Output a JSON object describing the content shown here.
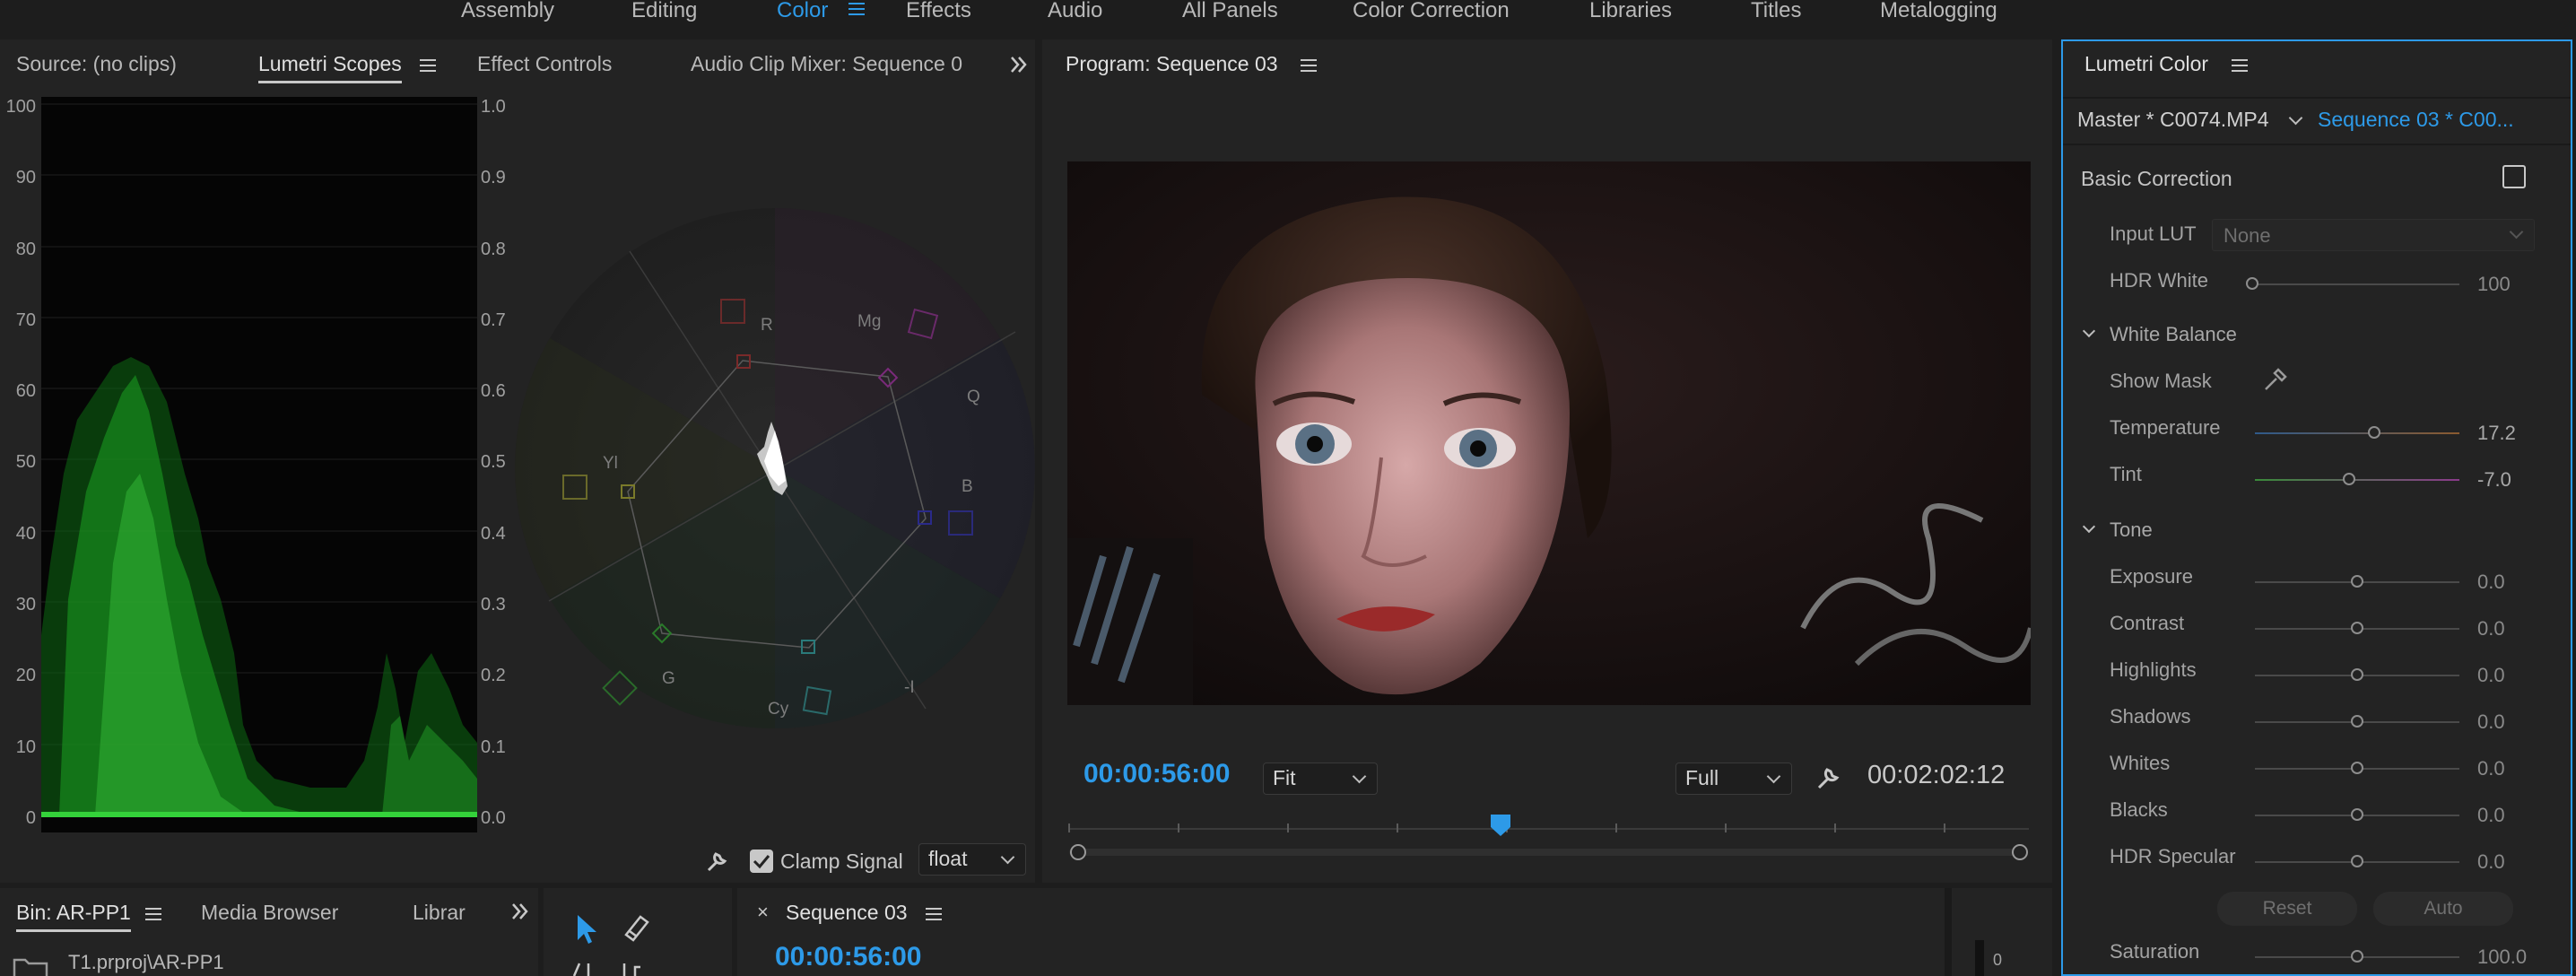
{
  "workspaces": [
    "Assembly",
    "Editing",
    "Color",
    "Effects",
    "Audio",
    "All Panels",
    "Color Correction",
    "Libraries",
    "Titles",
    "Metalogging"
  ],
  "active_workspace": "Color",
  "source_panel": {
    "tabs": [
      "Source: (no clips)",
      "Lumetri Scopes",
      "Effect Controls",
      "Audio Clip Mixer: Sequence 0"
    ],
    "active_tab": "Lumetri Scopes",
    "waveform_left_axis": [
      "100",
      "90",
      "80",
      "70",
      "60",
      "50",
      "40",
      "30",
      "20",
      "10",
      "0"
    ],
    "waveform_right_axis": [
      "1.0",
      "0.9",
      "0.8",
      "0.7",
      "0.6",
      "0.5",
      "0.4",
      "0.3",
      "0.2",
      "0.1",
      "0.0"
    ],
    "vectorscope_labels": {
      "r": "R",
      "mg": "Mg",
      "q": "Q",
      "b": "B",
      "yl": "Yl",
      "g": "G",
      "cy": "Cy",
      "i": "-I"
    },
    "clamp_signal_label": "Clamp Signal",
    "clamp_signal_checked": true,
    "precision": "float"
  },
  "program_monitor": {
    "title": "Program: Sequence 03",
    "current_time": "00:00:56:00",
    "zoom": "Fit",
    "resolution": "Full",
    "duration": "00:02:02:12"
  },
  "lumetri_color": {
    "title": "Lumetri Color",
    "master_clip": "Master * C0074.MP4",
    "sequence_clip": "Sequence 03 * C00...",
    "basic_correction_label": "Basic Correction",
    "input_lut_label": "Input LUT",
    "input_lut_value": "None",
    "hdr_white": {
      "label": "HDR White",
      "value": "100"
    },
    "white_balance_label": "White Balance",
    "show_mask_label": "Show Mask",
    "temperature": {
      "label": "Temperature",
      "value": "17.2"
    },
    "tint": {
      "label": "Tint",
      "value": "-7.0"
    },
    "tone_label": "Tone",
    "tone": [
      {
        "label": "Exposure",
        "value": "0.0"
      },
      {
        "label": "Contrast",
        "value": "0.0"
      },
      {
        "label": "Highlights",
        "value": "0.0"
      },
      {
        "label": "Shadows",
        "value": "0.0"
      },
      {
        "label": "Whites",
        "value": "0.0"
      },
      {
        "label": "Blacks",
        "value": "0.0"
      },
      {
        "label": "HDR Specular",
        "value": "0.0"
      }
    ],
    "reset_label": "Reset",
    "auto_label": "Auto",
    "saturation": {
      "label": "Saturation",
      "value": "100.0"
    }
  },
  "bin_panel": {
    "tabs": [
      "Bin: AR-PP1",
      "Media Browser",
      "Librar"
    ],
    "path": "T1.prproj\\AR-PP1"
  },
  "timeline": {
    "sequence_name": "Sequence 03",
    "current_time": "00:00:56:00",
    "meter_zero": "0"
  },
  "colors": {
    "accent": "#2d9ae8",
    "panel_bg": "#232323",
    "frame_bg": "#1d1d1d"
  }
}
